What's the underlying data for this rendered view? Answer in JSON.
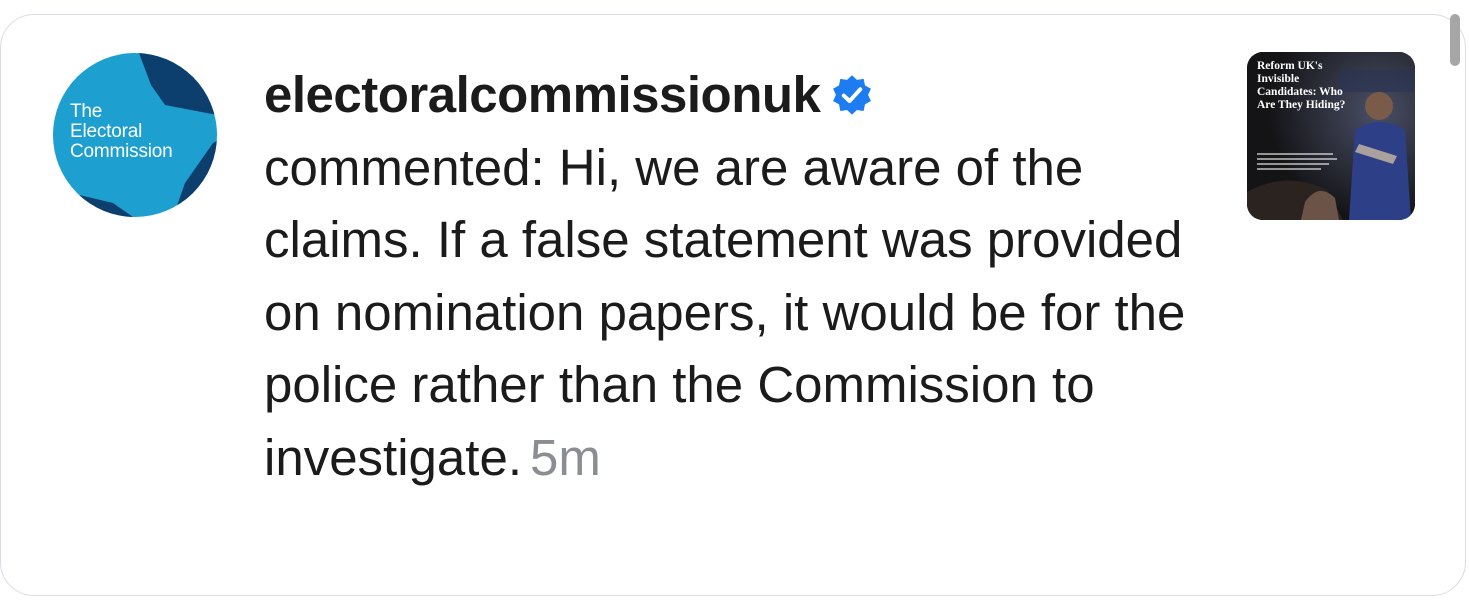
{
  "notification": {
    "avatar": {
      "line1": "The",
      "line2": "Electoral",
      "line3": "Commission",
      "icon": "electoral-commission-logo",
      "colors": {
        "background": "#1d9fcf",
        "shape": "#0d3f6e"
      }
    },
    "username": "electoralcommissionuk",
    "verified_icon": "verified-badge-icon",
    "verified_color": "#1d7cf2",
    "comment": "commented: Hi, we are aware of the claims. If a false statement was provided on nomination papers, it would be for the police rather than the Commission to investigate.",
    "time": "5m",
    "thumbnail": {
      "title_line1": "Reform UK's",
      "title_line2": "Invisible",
      "title_line3": "Candidates: Who",
      "title_line4": "Are They Hiding?"
    }
  }
}
